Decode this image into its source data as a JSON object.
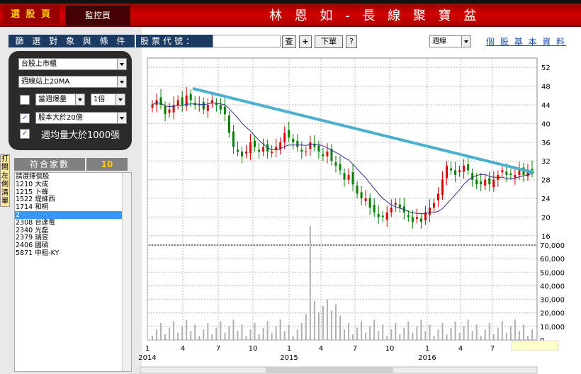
{
  "header": {
    "tab_select": "選 股 頁",
    "tab_monitor": "監控頁",
    "title": "林 恩 如 - 長 線 聚 寶 盆"
  },
  "filter": {
    "header": "篩 選 對 象 與 條 件",
    "market": "台股上市櫃",
    "ma_condition": "週線站上20MA",
    "volume_label": "當週爆量",
    "volume_checked": false,
    "multiplier": "1倍",
    "capital_label": "股本大於20億",
    "capital_checked": true,
    "avg_volume_label": "週均量大於1000張",
    "avg_volume_checked": true
  },
  "count": {
    "label": "符合家數",
    "value": "10"
  },
  "side_tab": "打開左側清單",
  "stock_list": [
    "請選擇個股",
    "1210  大成",
    "1215  卜蜂",
    "1522  堤維西",
    "1714  和桐",
    "2",
    "2308  台達電",
    "2340  光磊",
    "2379  瑞昱",
    "2406  國碩",
    "5871  中租-KY"
  ],
  "toolbar": {
    "code_label": "股票代號：",
    "query": "查",
    "plus": "+",
    "order": "下單",
    "help": "?",
    "period": "週線",
    "basic_info": "個 股 基 本 資 料"
  },
  "chart_data": {
    "type": "candlestick",
    "period": "weekly",
    "price_ticks": [
      52,
      48,
      44,
      40,
      36,
      32,
      28,
      24,
      20,
      16
    ],
    "volume_ticks": [
      "70,000",
      "60,000",
      "50,000",
      "40,000",
      "30,000",
      "20,000",
      "10,000",
      "0"
    ],
    "x_ticks": [
      "1",
      "4",
      "7",
      "10",
      "1",
      "4",
      "7",
      "10",
      "1",
      "4",
      "7"
    ],
    "year_labels": [
      "2014",
      "2015",
      "2016"
    ],
    "price_range": [
      14,
      54
    ],
    "volume_range": [
      0,
      70000
    ],
    "trendline": {
      "from": 47.5,
      "to": 29.5
    },
    "ma_color": "#303090",
    "trendline_color": "#4ab0d0",
    "up_color": "#e00000",
    "down_color": "#008000",
    "close_path": [
      44,
      45,
      44,
      42,
      43,
      44,
      45,
      44,
      46,
      45,
      44,
      44,
      43,
      44,
      45,
      44,
      43,
      42,
      38,
      35,
      34,
      33,
      34,
      36,
      35,
      34,
      35,
      34,
      34,
      35,
      36,
      38,
      37,
      36,
      35,
      34,
      34,
      36,
      35,
      34,
      33,
      34,
      32,
      31,
      30,
      28,
      29,
      27,
      25,
      24,
      24,
      22,
      21,
      20,
      20,
      21,
      22,
      23,
      22,
      21,
      20,
      19,
      20,
      19,
      21,
      22,
      23,
      25,
      28,
      31,
      30,
      29,
      30,
      31,
      30,
      28,
      27,
      27,
      28,
      27,
      28,
      29,
      30,
      29,
      29,
      29,
      30,
      29,
      30,
      30
    ]
  }
}
